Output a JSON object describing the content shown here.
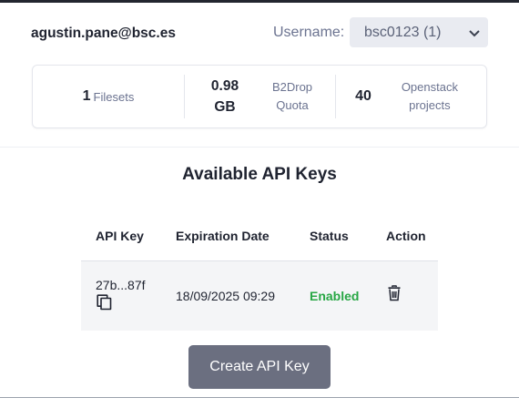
{
  "header": {
    "email": "agustin.pane@bsc.es",
    "username_label": "Username:",
    "username_selected": "bsc0123 (1)",
    "icons": {
      "select": "chevron-down-icon"
    }
  },
  "stats": {
    "filesets_count": "1",
    "filesets_label": "Filesets",
    "b2drop_value_line1": "0.98",
    "b2drop_value_line2": "GB",
    "b2drop_label_line1": "B2Drop",
    "b2drop_label_line2": "Quota",
    "openstack_count": "40",
    "openstack_label_line1": "Openstack",
    "openstack_label_line2": "projects"
  },
  "api_keys": {
    "title": "Available API Keys",
    "columns": [
      "API Key",
      "Expiration Date",
      "Status",
      "Action"
    ],
    "rows": [
      {
        "key": "27b...87f",
        "expiration": "18/09/2025 09:29",
        "status": "Enabled",
        "icons": [
          "copy-icon",
          "trash-icon"
        ]
      }
    ],
    "status_color": "#28a745",
    "create_label": "Create API Key"
  }
}
